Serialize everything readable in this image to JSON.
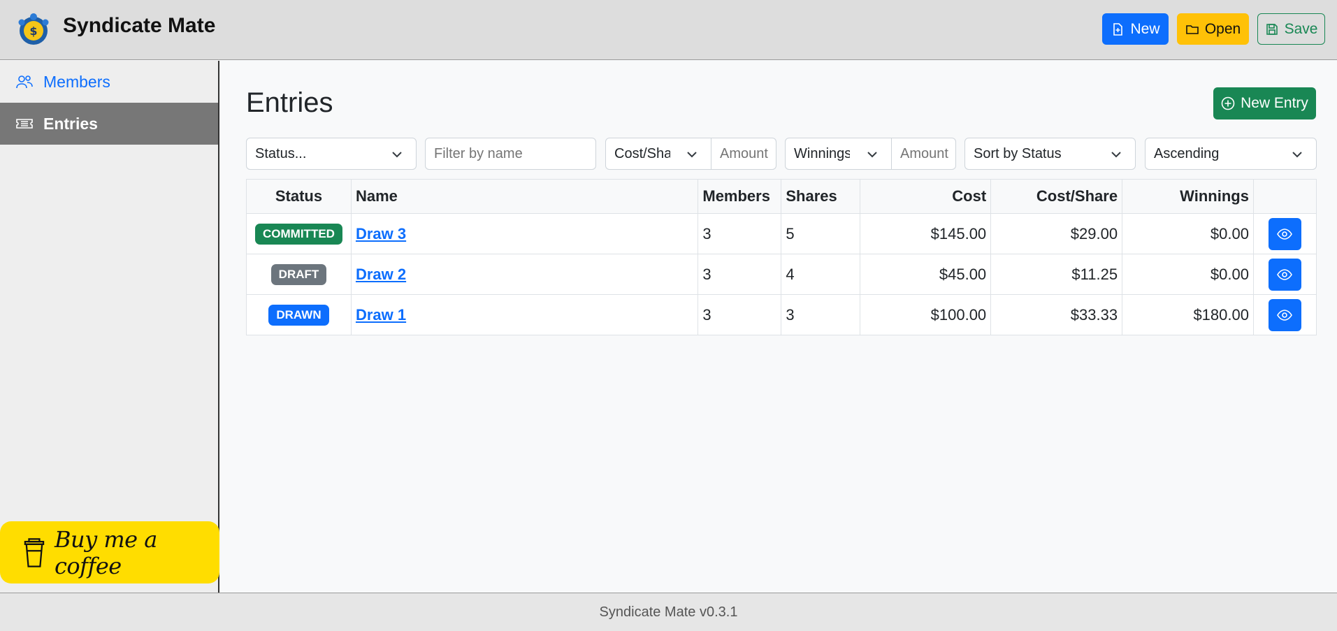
{
  "app": {
    "title": "Syndicate Mate"
  },
  "header": {
    "new_label": "New",
    "open_label": "Open",
    "save_label": "Save"
  },
  "sidebar": {
    "items": [
      {
        "label": "Members",
        "icon": "people-icon"
      },
      {
        "label": "Entries",
        "icon": "ticket-icon",
        "active": true
      }
    ],
    "coffee_label": "Buy me a coffee"
  },
  "main": {
    "title": "Entries",
    "new_entry_label": "New Entry",
    "filters": {
      "status": "Status...",
      "name_placeholder": "Filter by name",
      "cost_share_select": "Cost/Share",
      "cost_share_placeholder": "Amount",
      "winnings_select": "Winnings",
      "winnings_placeholder": "Amount",
      "sort_by": "Sort by Status",
      "order": "Ascending"
    },
    "table": {
      "columns": [
        "Status",
        "Name",
        "Members",
        "Shares",
        "Cost",
        "Cost/Share",
        "Winnings"
      ],
      "rows": [
        {
          "status": "COMMITTED",
          "status_color": "#198754",
          "name": "Draw 3",
          "members": "3",
          "shares": "5",
          "cost": "$145.00",
          "cost_share": "$29.00",
          "winnings": "$0.00"
        },
        {
          "status": "DRAFT",
          "status_color": "#6c757d",
          "name": "Draw 2",
          "members": "3",
          "shares": "4",
          "cost": "$45.00",
          "cost_share": "$11.25",
          "winnings": "$0.00"
        },
        {
          "status": "DRAWN",
          "status_color": "#0d6efd",
          "name": "Draw 1",
          "members": "3",
          "shares": "3",
          "cost": "$100.00",
          "cost_share": "$33.33",
          "winnings": "$180.00"
        }
      ]
    }
  },
  "footer": {
    "text": "Syndicate Mate v0.3.1"
  },
  "colors": {
    "primary": "#0d6efd",
    "success": "#198754",
    "warning": "#ffc107",
    "secondary": "#6c757d",
    "coffee": "#ffdd00"
  }
}
